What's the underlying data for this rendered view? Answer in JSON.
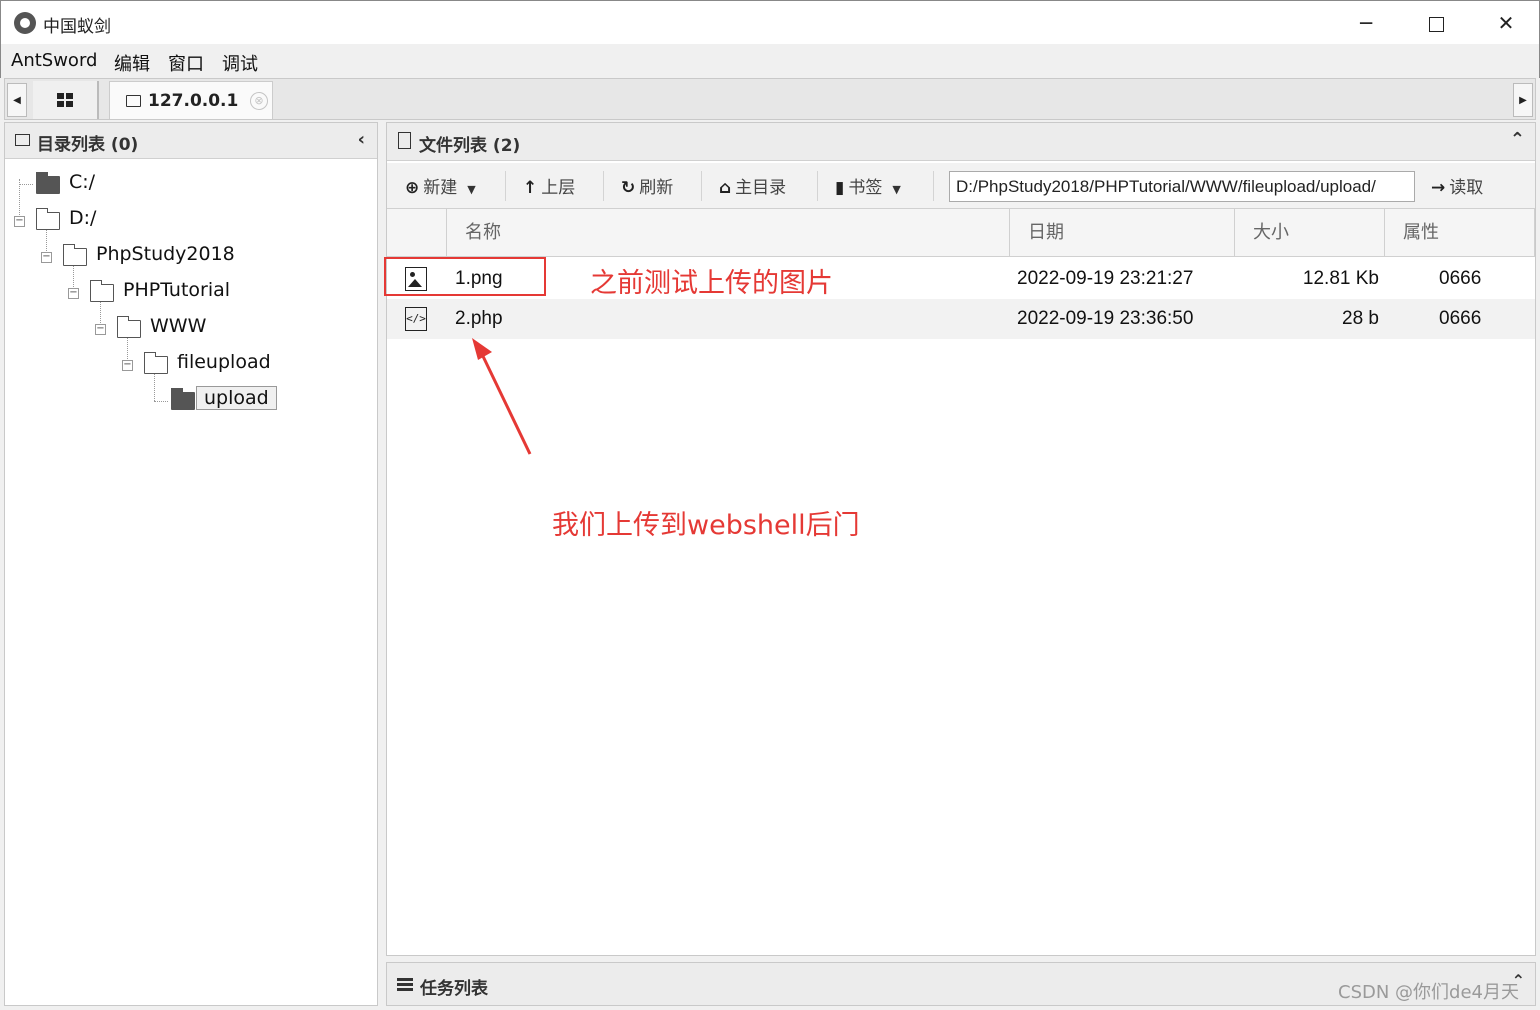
{
  "window": {
    "title": "中国蚁剑",
    "controls": {
      "minimize": "─",
      "close": "✕"
    }
  },
  "menu": [
    "AntSword",
    "编辑",
    "窗口",
    "调试"
  ],
  "tabs": {
    "host_label": "127.0.0.1",
    "close_symbol": "⊗"
  },
  "left_panel": {
    "title": "目录列表 (0)",
    "collapse_symbol": "‹",
    "tree": [
      {
        "label": "C:/",
        "depth": 0,
        "selected": false
      },
      {
        "label": "D:/",
        "depth": 0,
        "selected": false
      },
      {
        "label": "PhpStudy2018",
        "depth": 1,
        "selected": false
      },
      {
        "label": "PHPTutorial",
        "depth": 2,
        "selected": false
      },
      {
        "label": "WWW",
        "depth": 3,
        "selected": false
      },
      {
        "label": "fileupload",
        "depth": 4,
        "selected": false
      },
      {
        "label": "upload",
        "depth": 5,
        "selected": true
      }
    ]
  },
  "right_panel": {
    "title": "文件列表 (2)",
    "collapse_symbol": "⌃",
    "toolbar": {
      "new": "新建",
      "up": "上层",
      "refresh": "刷新",
      "home": "主目录",
      "bookmark": "书签",
      "read": "读取",
      "path_value": "D:/PhpStudy2018/PHPTutorial/WWW/fileupload/upload/"
    },
    "columns": [
      "名称",
      "日期",
      "大小",
      "属性"
    ],
    "files": [
      {
        "icon": "image-file-icon",
        "name": "1.png",
        "date": "2022-09-19 23:21:27",
        "size": "12.81 Kb",
        "attr": "0666"
      },
      {
        "icon": "code-file-icon",
        "name": "2.php",
        "date": "2022-09-19 23:36:50",
        "size": "28 b",
        "attr": "0666"
      }
    ]
  },
  "annotations": {
    "note_1": "之前测试上传的图片",
    "note_2": "我们上传到webshell后门",
    "color": "#e53935"
  },
  "task_panel": {
    "title": "任务列表",
    "collapse_symbol": "⌃"
  },
  "watermark": "CSDN @你们de4月天"
}
